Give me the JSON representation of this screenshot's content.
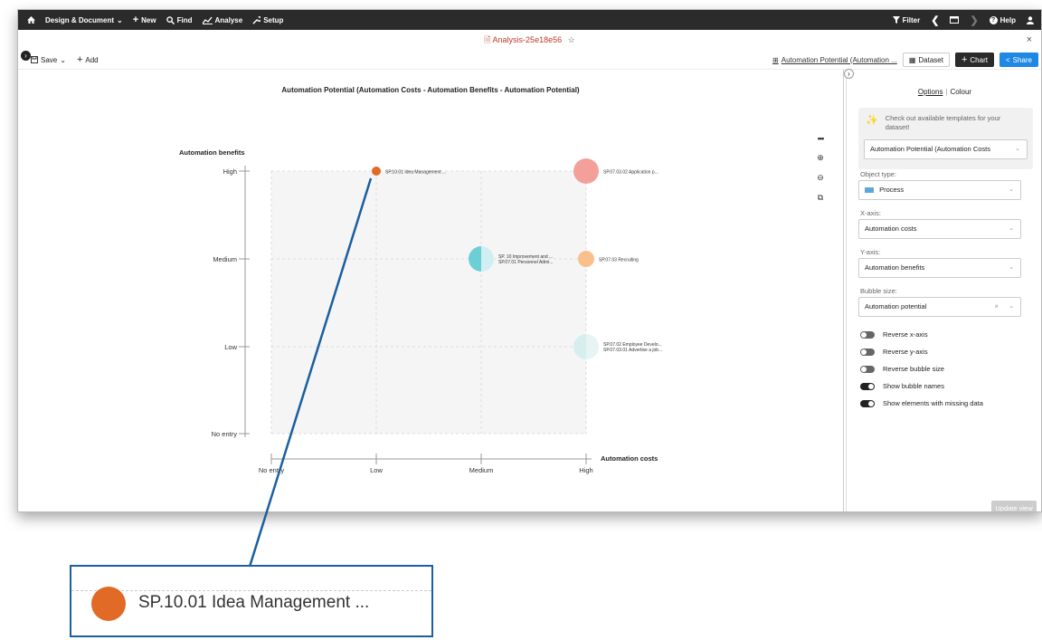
{
  "nav": {
    "home_icon": "home-icon",
    "items": [
      {
        "label": "Design & Document",
        "icon": "chevron-down-icon"
      },
      {
        "label": "New",
        "icon": "plus-icon"
      },
      {
        "label": "Find",
        "icon": "search-icon"
      },
      {
        "label": "Analyse",
        "icon": "chart-icon"
      },
      {
        "label": "Setup",
        "icon": "wrench-icon"
      }
    ],
    "filter_label": "Filter",
    "help_label": "Help"
  },
  "window": {
    "title": "Analysis-25e18e56",
    "close": "×",
    "star": "☆"
  },
  "toolbar": {
    "save_label": "Save",
    "add_label": "Add",
    "template_link": "Automation Potential (Automation ...",
    "dataset_label": "Dataset",
    "chart_label": "Chart",
    "share_label": "Share"
  },
  "chart_data": {
    "type": "scatter",
    "title": "Automation Potential (Automation Costs - Automation Benefits - Automation Potential)",
    "xlabel": "Automation costs",
    "ylabel": "Automation benefits",
    "x_categories": [
      "No entry",
      "Low",
      "Medium",
      "High"
    ],
    "y_categories": [
      "No entry",
      "Low",
      "Medium",
      "High"
    ],
    "points": [
      {
        "name": "SP.10.01 Idea Management ...",
        "x": "Low",
        "y": "High",
        "size": "small",
        "color": "#e06a26"
      },
      {
        "name": "SP.07.03.02 Application p...",
        "x": "High",
        "y": "High",
        "size": "large",
        "color": "#f4a09a"
      },
      {
        "name": "SP. 10 Improvement and ...",
        "name2": "SP.07.01 Personnel Admi...",
        "x": "Medium",
        "y": "Medium",
        "size": "medium",
        "color": "#6dcfd6",
        "split": true
      },
      {
        "name": "SP.07.03 Recruiting",
        "x": "High",
        "y": "Medium",
        "size": "small",
        "color": "#f9c08c"
      },
      {
        "name": "SP.07.02 Employee Develo...",
        "name2": "SP.07.03.01 Advertise a job...",
        "x": "High",
        "y": "Low",
        "size": "medium",
        "color": "#d7eeee",
        "split": true
      }
    ],
    "grid": true
  },
  "chart_tools": [
    "more-icon",
    "zoom-in-icon",
    "zoom-out-icon",
    "export-icon"
  ],
  "panel": {
    "tab_options": "Options",
    "tab_colour": "Colour",
    "template_hint": "Check out available templates for your dataset!",
    "template_select": "Automation Potential (Automation Costs",
    "object_type_label": "Object type:",
    "object_type_value": "Process",
    "x_axis_label": "X-axis:",
    "x_axis_value": "Automation costs",
    "y_axis_label": "Y-axis:",
    "y_axis_value": "Automation benefits",
    "bubble_size_label": "Bubble size:",
    "bubble_size_value": "Automation potential",
    "toggles": [
      {
        "label": "Reverse x-axis",
        "on": false
      },
      {
        "label": "Reverse y-axis",
        "on": false
      },
      {
        "label": "Reverse bubble size",
        "on": false
      },
      {
        "label": "Show bubble names",
        "on": true
      },
      {
        "label": "Show elements with missing data",
        "on": true
      }
    ],
    "update_label": "Update view"
  },
  "zoom": {
    "label": "SP.10.01 Idea Management ..."
  }
}
